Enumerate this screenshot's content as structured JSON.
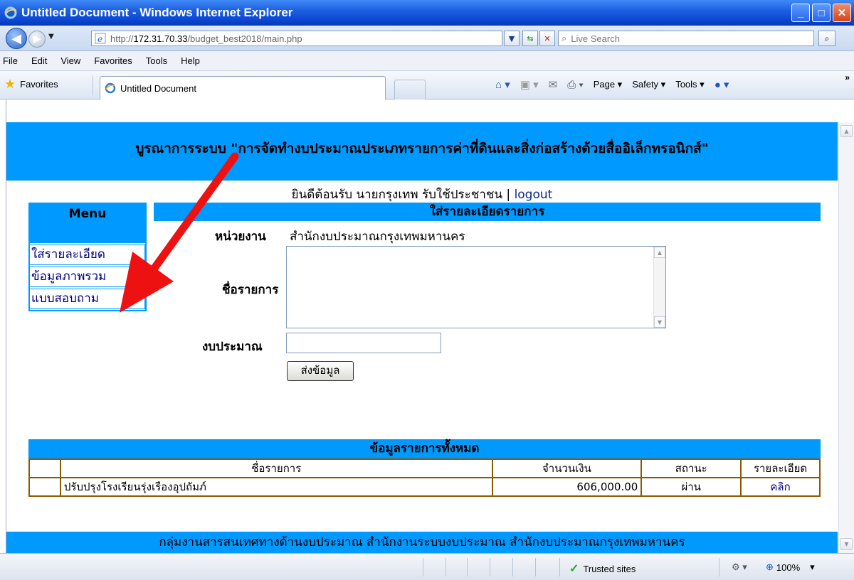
{
  "window": {
    "title": "Untitled Document - Windows Internet Explorer"
  },
  "address": {
    "url_prefix": "http://",
    "url_host": "172.31.70.33",
    "url_path": "/budget_best2018/main.php",
    "search_placeholder": "Live Search"
  },
  "menubar": {
    "items": [
      "File",
      "Edit",
      "View",
      "Favorites",
      "Tools",
      "Help"
    ]
  },
  "favbar": {
    "favorites_label": "Favorites",
    "tab_title": "Untitled Document",
    "page_label": "Page",
    "safety_label": "Safety",
    "tools_label": "Tools"
  },
  "page": {
    "banner": "บูรณาการระบบ \"การจัดทำงบประมาณประเภทรายการค่าที่ดินและสิ่งก่อสร้างด้วยสื่ออิเล็กทรอนิกส์\"",
    "welcome": "ยินดีต้อนรับ นายกรุงเทพ รับใช้ประชาชน | ",
    "logout": "logout",
    "menu": {
      "title": "Menu",
      "items": [
        "ใส่รายละเอียด",
        "ข้อมูลภาพรวม",
        "แบบสอบถาม"
      ]
    },
    "form": {
      "title": "ใส่รายละเอียดรายการ",
      "agency_label": "หน่วยงาน",
      "agency_value": "สำนักงบประมาณกรุงเทพมหานคร",
      "name_label": "ชื่อรายการ",
      "name_value": "",
      "budget_label": "งบประมาณ",
      "budget_value": "",
      "submit_label": "ส่งข้อมูล"
    },
    "table": {
      "title": "ข้อมูลรายการทั้งหมด",
      "columns": [
        "",
        "ชื่อรายการ",
        "จำนวนเงิน",
        "สถานะ",
        "รายละเอียด"
      ],
      "rows": [
        {
          "index": "",
          "name": "ปรับปรุงโรงเรียนรุ่งเรืองอุปถัมภ์",
          "amount": "606,000.00",
          "status": "ผ่าน",
          "detail": "คลิก"
        }
      ]
    },
    "footer": "กลุ่มงานสารสนเทศทางด้านงบประมาณ สำนักงานระบบงบประมาณ สำนักงบประมาณกรุงเทพมหานคร"
  },
  "statusbar": {
    "zone": "Trusted sites",
    "zoom": "100%"
  },
  "colors": {
    "accent_blue": "#0099ff",
    "table_border": "#8a5a00",
    "arrow_red": "#ee1111",
    "title_blue": "#0a46d2"
  }
}
